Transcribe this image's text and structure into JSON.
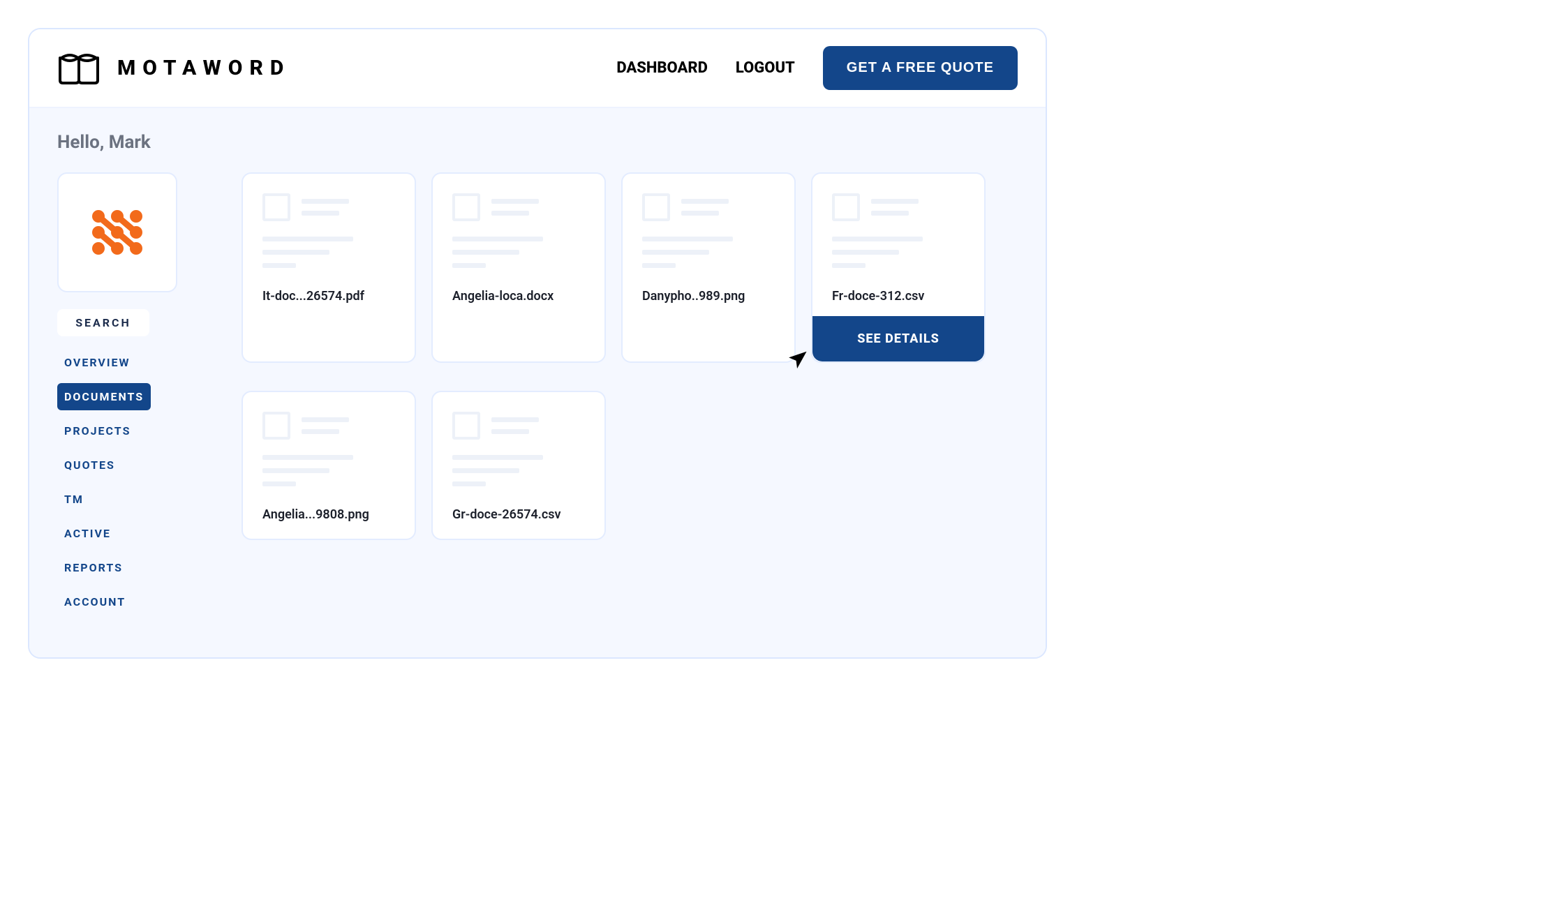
{
  "brand": {
    "name": "MOTAWORD"
  },
  "topnav": {
    "dashboard": "DASHBOARD",
    "logout": "LOGOUT",
    "quote": "GET A FREE QUOTE"
  },
  "greeting": "Hello, Mark",
  "sidebar": {
    "search": "SEARCH",
    "items": [
      {
        "label": "OVERVIEW",
        "active": false
      },
      {
        "label": "DOCUMENTS",
        "active": true
      },
      {
        "label": "PROJECTS",
        "active": false
      },
      {
        "label": "QUOTES",
        "active": false
      },
      {
        "label": "TM",
        "active": false
      },
      {
        "label": "ACTIVE",
        "active": false
      },
      {
        "label": "REPORTS",
        "active": false
      },
      {
        "label": "ACCOUNT",
        "active": false
      }
    ]
  },
  "documents": [
    {
      "name": "It-doc...26574.pdf"
    },
    {
      "name": "Angelia-loca.docx"
    },
    {
      "name": "Danypho..989.png"
    },
    {
      "name": "Fr-doce-312.csv",
      "hover": true,
      "cta": "SEE DETAILS"
    },
    {
      "name": "Angelia...9808.png"
    },
    {
      "name": "Gr-doce-26574.csv"
    }
  ]
}
